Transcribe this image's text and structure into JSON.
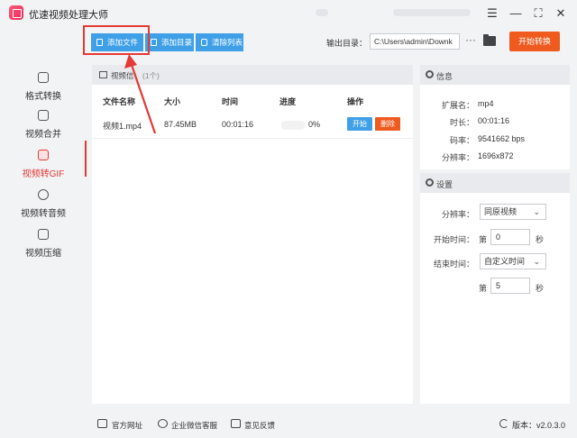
{
  "app": {
    "title": "优速视频处理大师"
  },
  "window": {
    "menu": "☰",
    "minimize": "—",
    "maximize": "⛶",
    "close": "✕"
  },
  "toolbar": {
    "add_file": "添加文件",
    "add_folder": "添加目录",
    "clear_list": "清除列表",
    "output_label": "输出目录：",
    "output_path": "C:\\Users\\admin\\Downk",
    "more": "···",
    "start_convert": "开始转换"
  },
  "sidebar": {
    "items": [
      {
        "label": "格式转换",
        "icon": "format-icon"
      },
      {
        "label": "视频合并",
        "icon": "merge-icon"
      },
      {
        "label": "视频转GIF",
        "icon": "gif-icon",
        "active": true
      },
      {
        "label": "视频转音频",
        "icon": "audio-icon"
      },
      {
        "label": "视频压缩",
        "icon": "compress-icon"
      }
    ]
  },
  "file_list": {
    "title": "视频信",
    "count": "(1个)",
    "columns": [
      "文件名称",
      "大小",
      "时间",
      "进度",
      "操作"
    ],
    "rows": [
      {
        "name": "视频1.mp4",
        "size": "87.45MB",
        "time": "00:01:16",
        "progress": "0%",
        "start": "开始",
        "delete": "删除"
      }
    ]
  },
  "info": {
    "title": "信息",
    "ext_label": "扩展名：",
    "ext": "mp4",
    "duration_label": "时长：",
    "duration": "00:01:16",
    "bitrate_label": "码率：",
    "bitrate": "9541662 bps",
    "resolution_label": "分辨率：",
    "resolution": "1696x872"
  },
  "settings": {
    "title": "设置",
    "resolution_label": "分辨率：",
    "resolution_value": "同原视频",
    "start_label": "开始时间：",
    "start_prefix": "第",
    "start_value": "0",
    "start_unit": "秒",
    "end_label": "结束时间：",
    "end_value": "自定义时间",
    "end_prefix": "第",
    "end_seconds": "5",
    "end_unit": "秒"
  },
  "footer": {
    "website": "官方网址",
    "wechat": "企业微信客服",
    "feedback": "意见反馈",
    "version": "版本：v2.0.3.0"
  },
  "colors": {
    "primary": "#3fa0e8",
    "accent": "#ef5a1e",
    "highlight": "#e53935"
  }
}
